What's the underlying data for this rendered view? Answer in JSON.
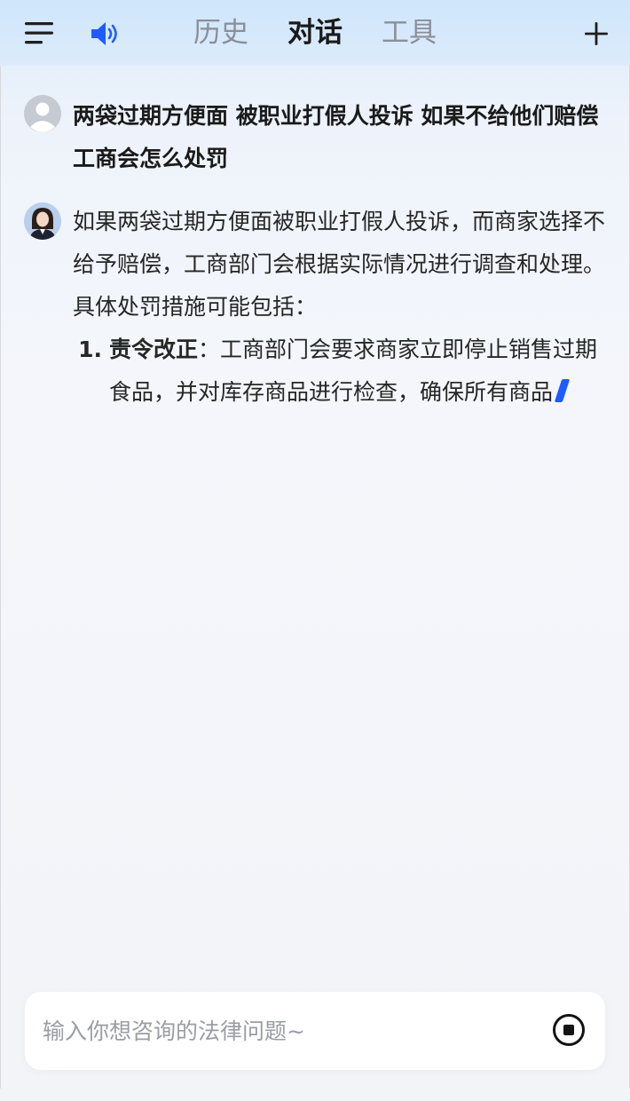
{
  "header": {
    "tabs": [
      {
        "label": "历史",
        "active": false
      },
      {
        "label": "对话",
        "active": true
      },
      {
        "label": "工具",
        "active": false
      }
    ],
    "icons": {
      "menu": "menu-icon",
      "speaker": "speaker-icon",
      "new": "plus-icon"
    }
  },
  "conversation": {
    "user_message": "两袋过期方便面 被职业打假人投诉 如果不给他们赔偿 工商会怎么处罚",
    "bot_message": {
      "intro": "如果两袋过期方便面被职业打假人投诉，而商家选择不给予赔偿，工商部门会根据实际情况进行调查和处理。具体处罚措施可能包括：",
      "list": [
        {
          "number": "1.",
          "title": "责令改正",
          "text": "：工商部门会要求商家立即停止销售过期食品，并对库存商品进行检查，确保所有商品"
        }
      ]
    }
  },
  "input": {
    "placeholder": "输入你想咨询的法律问题~",
    "value": ""
  },
  "colors": {
    "accent": "#1f5cff",
    "header_bg": "#d6e8fb",
    "page_bg": "#f4f6fb"
  }
}
